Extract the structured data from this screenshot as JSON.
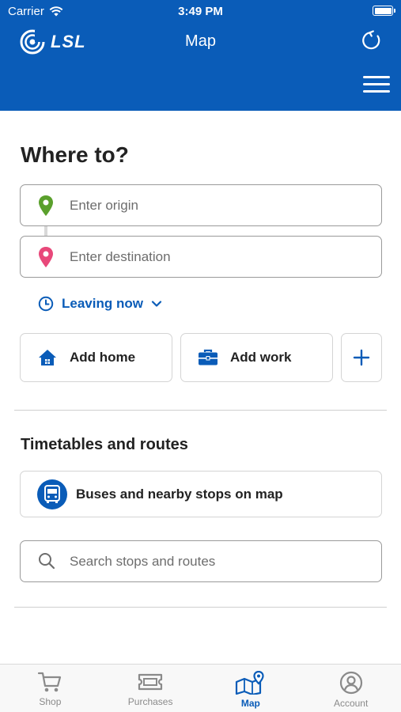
{
  "status_bar": {
    "carrier": "Carrier",
    "time": "3:49 PM"
  },
  "header": {
    "brand": "LSL",
    "title": "Map"
  },
  "page": {
    "title": "Where to?"
  },
  "trip": {
    "origin_placeholder": "Enter origin",
    "destination_placeholder": "Enter destination",
    "time_option": "Leaving now"
  },
  "shortcuts": {
    "home": "Add home",
    "work": "Add work"
  },
  "timetables": {
    "title": "Timetables and routes",
    "buses_label": "Buses and nearby stops on map",
    "search_placeholder": "Search stops and routes"
  },
  "tabs": [
    {
      "label": "Shop",
      "icon": "cart-icon"
    },
    {
      "label": "Purchases",
      "icon": "ticket-icon"
    },
    {
      "label": "Map",
      "icon": "map-icon",
      "active": true
    },
    {
      "label": "Account",
      "icon": "account-icon"
    }
  ],
  "colors": {
    "brand_blue": "#0a5cb8",
    "origin_green": "#5aa02c",
    "destination_pink": "#e8487a"
  }
}
